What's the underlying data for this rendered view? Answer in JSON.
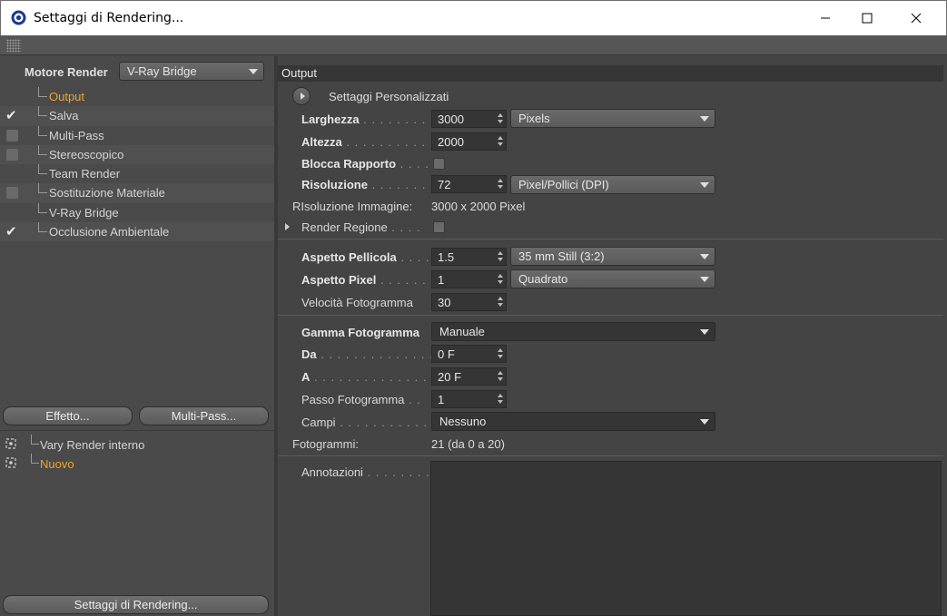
{
  "window": {
    "title": "Settaggi di Rendering...",
    "minimize_label": "Minimize",
    "maximize_label": "Maximize",
    "close_label": "Close"
  },
  "left": {
    "engine_label": "Motore Render",
    "engine_value": "V-Ray Bridge",
    "tree": [
      {
        "label": "Output",
        "checked": null,
        "active": true
      },
      {
        "label": "Salva",
        "checked": true,
        "active": false
      },
      {
        "label": "Multi-Pass",
        "checked": false,
        "active": false
      },
      {
        "label": "Stereoscopico",
        "checked": false,
        "active": false
      },
      {
        "label": "Team Render",
        "checked": null,
        "active": false
      },
      {
        "label": "Sostituzione Materiale",
        "checked": false,
        "active": false
      },
      {
        "label": "V-Ray Bridge",
        "checked": null,
        "active": false
      },
      {
        "label": "Occlusione Ambientale",
        "checked": true,
        "active": false
      }
    ],
    "effect_button": "Effetto...",
    "multipass_button": "Multi-Pass...",
    "settings_list": [
      {
        "label": "Vary Render interno",
        "active": false
      },
      {
        "label": "Nuovo",
        "active": true
      }
    ],
    "render_settings_button": "Settaggi di Rendering..."
  },
  "output": {
    "section_title": "Output",
    "preset_label": "Settaggi  Personalizzati",
    "width": {
      "label": "Larghezza",
      "dots": " . . . . . . . . .",
      "value": "3000",
      "unit": "Pixels"
    },
    "height": {
      "label": "Altezza",
      "dots": " . . . . . . . . . . .",
      "value": "2000"
    },
    "lock_ratio": {
      "label": "Blocca Rapporto",
      "dots": " . . . .",
      "checked": false
    },
    "resolution": {
      "label": "Risoluzione",
      "dots": " . . . . . . . .",
      "value": "72",
      "unit": "Pixel/Pollici (DPI)"
    },
    "image_resolution": {
      "label": "RIsoluzione Immagine:",
      "value": "3000 x 2000 Pixel"
    },
    "render_region": {
      "label": "Render Regione",
      "dots": " . . . .",
      "checked": false
    },
    "film_aspect": {
      "label": "Aspetto Pellicola",
      "dots": " . . . .",
      "value": "1.5",
      "preset": "35 mm Still (3:2)"
    },
    "pixel_aspect": {
      "label": "Aspetto Pixel",
      "dots": " . . . . . . .",
      "value": "1",
      "preset": "Quadrato"
    },
    "frame_rate": {
      "label": "Velocità Fotogramma",
      "value": "30"
    },
    "frame_range": {
      "label": "Gamma Fotogramma",
      "value": "Manuale"
    },
    "from": {
      "label": "Da",
      "dots": " . . . . . . . . . . . . . . .",
      "value": "0 F"
    },
    "to": {
      "label": "A",
      "dots": " . . . . . . . . . . . . . . . .",
      "value": "20 F"
    },
    "frame_step": {
      "label": "Passo Fotogramma",
      "dots": " . .",
      "value": "1"
    },
    "fields": {
      "label": "Campi",
      "dots": " . . . . . . . . . . . .",
      "value": "Nessuno"
    },
    "frames": {
      "label": "Fotogrammi:",
      "value": "21 (da 0 a 20)"
    },
    "annotations": {
      "label": "Annotazioni",
      "dots": " . . . . . . . .",
      "value": ""
    }
  },
  "colors": {
    "accent": "#f0a42a",
    "panel": "#444444",
    "field": "#353535"
  }
}
